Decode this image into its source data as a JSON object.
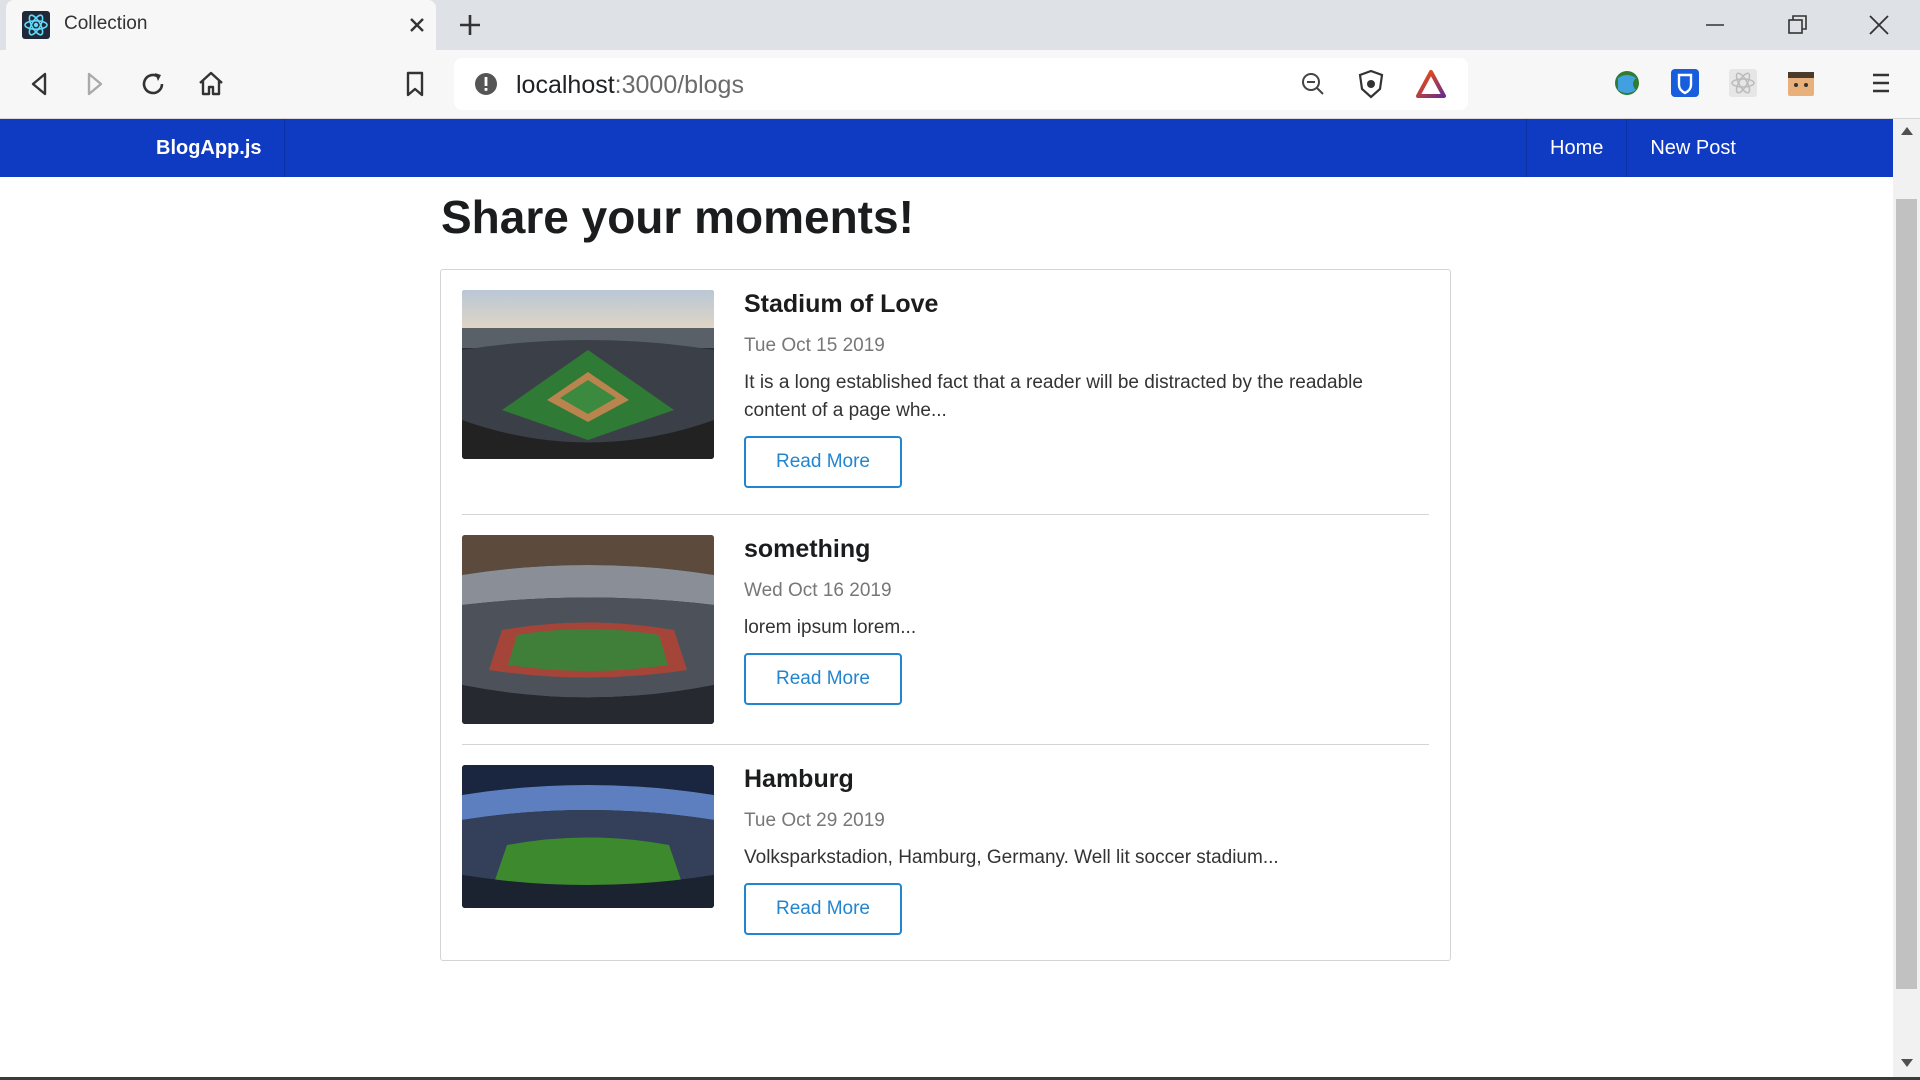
{
  "browser": {
    "tab_title": "Collection",
    "url_host": "localhost",
    "url_rest": ":3000/blogs"
  },
  "navbar": {
    "brand": "BlogApp.js",
    "links": [
      "Home",
      "New Post"
    ],
    "background": "#0f3ac2"
  },
  "page": {
    "title": "Share your moments!"
  },
  "posts": [
    {
      "title": "Stadium of Love",
      "date": "Tue Oct 15 2019",
      "description": "It is a long established fact that a reader will be distracted by the readable content of a page whe...",
      "button": "Read More",
      "image": "baseball-stadium-photo"
    },
    {
      "title": "something",
      "date": "Wed Oct 16 2019",
      "description": "lorem ipsum lorem...",
      "button": "Read More",
      "image": "soccer-stadium-photo"
    },
    {
      "title": "Hamburg",
      "date": "Tue Oct 29 2019",
      "description": "Volksparkstadion, Hamburg, Germany. Well lit soccer stadium...",
      "button": "Read More",
      "image": "night-stadium-photo"
    }
  ],
  "colors": {
    "accent": "#2185d0"
  }
}
